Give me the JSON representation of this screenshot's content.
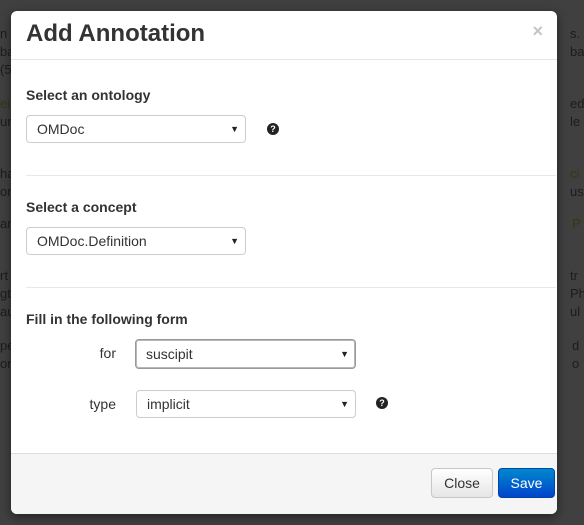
{
  "background": {
    "fragments": [
      {
        "text": "n c"
      },
      {
        "text": "s."
      },
      {
        "text": "ba"
      },
      {
        "text": "ba"
      },
      {
        "text": "(5"
      },
      {
        "text": "ei"
      },
      {
        "text": "ed"
      },
      {
        "text": "un"
      },
      {
        "text": "le"
      },
      {
        "text": "ha"
      },
      {
        "text": "ci"
      },
      {
        "text": "or"
      },
      {
        "text": "us"
      },
      {
        "text": "ar"
      },
      {
        "text": "P"
      },
      {
        "text": "rt"
      },
      {
        "text": "tr"
      },
      {
        "text": "gt"
      },
      {
        "text": "Ph"
      },
      {
        "text": "au"
      },
      {
        "text": "ul"
      },
      {
        "text": "pe"
      },
      {
        "text": "d"
      },
      {
        "text": "on"
      },
      {
        "text": "o"
      }
    ]
  },
  "modal": {
    "title": "Add Annotation",
    "close_glyph": "×",
    "ontology": {
      "label": "Select an ontology",
      "selected": "OMDoc",
      "help": "?"
    },
    "concept": {
      "label": "Select a concept",
      "selected": "OMDoc.Definition"
    },
    "form": {
      "label": "Fill in the following form",
      "fields": [
        {
          "label": "for",
          "value": "suscipit"
        },
        {
          "label": "type",
          "value": "implicit",
          "help": "?"
        }
      ]
    },
    "footer": {
      "close_label": "Close",
      "save_label": "Save"
    },
    "caret": "▼"
  }
}
